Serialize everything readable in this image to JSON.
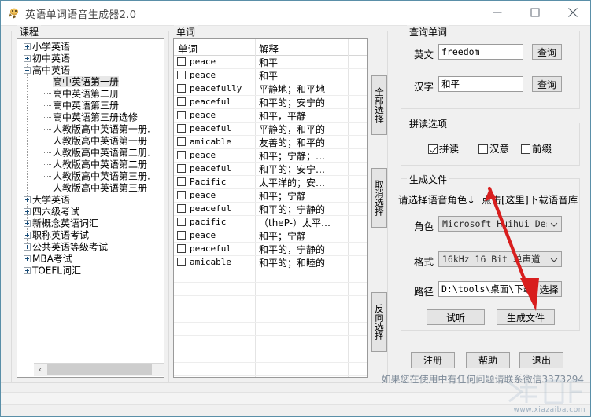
{
  "window": {
    "title": "英语单词语音生成器2.0",
    "icon": "app-icon",
    "minimize": "—",
    "maximize": "□",
    "close": "✕"
  },
  "course_panel": {
    "legend": "课程",
    "nodes": [
      {
        "label": "小学英语",
        "level": 0,
        "toggle": "plus"
      },
      {
        "label": "初中英语",
        "level": 0,
        "toggle": "plus"
      },
      {
        "label": "高中英语",
        "level": 0,
        "toggle": "minus"
      },
      {
        "label": "高中英语第一册",
        "level": 1,
        "toggle": "none",
        "selected": true
      },
      {
        "label": "高中英语第二册",
        "level": 1,
        "toggle": "none"
      },
      {
        "label": "高中英语第三册",
        "level": 1,
        "toggle": "none"
      },
      {
        "label": "高中英语第三册选修",
        "level": 1,
        "toggle": "none"
      },
      {
        "label": "人教版高中英语第一册.",
        "level": 1,
        "toggle": "none"
      },
      {
        "label": "人教版高中英语第一册",
        "level": 1,
        "toggle": "none"
      },
      {
        "label": "人教版高中英语第二册.",
        "level": 1,
        "toggle": "none"
      },
      {
        "label": "人教版高中英语第二册",
        "level": 1,
        "toggle": "none"
      },
      {
        "label": "人教版高中英语第三册.",
        "level": 1,
        "toggle": "none"
      },
      {
        "label": "人教版高中英语第三册",
        "level": 1,
        "toggle": "none"
      },
      {
        "label": "大学英语",
        "level": 0,
        "toggle": "plus"
      },
      {
        "label": "四六级考试",
        "level": 0,
        "toggle": "plus"
      },
      {
        "label": "新概念英语词汇",
        "level": 0,
        "toggle": "plus"
      },
      {
        "label": "职称英语考试",
        "level": 0,
        "toggle": "plus"
      },
      {
        "label": "公共英语等级考试",
        "level": 0,
        "toggle": "plus"
      },
      {
        "label": "MBA考试",
        "level": 0,
        "toggle": "plus"
      },
      {
        "label": "TOEFL词汇",
        "level": 0,
        "toggle": "plus"
      }
    ],
    "scroll_left": "‹",
    "scroll_right": "›"
  },
  "word_panel": {
    "legend": "单词",
    "columns": [
      "单词",
      "解释"
    ],
    "rows": [
      {
        "word": "peace",
        "meaning": "和平"
      },
      {
        "word": "peace",
        "meaning": "和平"
      },
      {
        "word": "peacefully",
        "meaning": "平静地；和平地"
      },
      {
        "word": "peaceful",
        "meaning": "和平的；安宁的"
      },
      {
        "word": "peace",
        "meaning": "和平，平静"
      },
      {
        "word": "peaceful",
        "meaning": "平静的，和平的"
      },
      {
        "word": "amicable",
        "meaning": "友善的；和平的"
      },
      {
        "word": "peace",
        "meaning": "和平；宁静；…"
      },
      {
        "word": "peaceful",
        "meaning": "和平的；安宁…"
      },
      {
        "word": "Pacific",
        "meaning": "太平洋的；安…"
      },
      {
        "word": "peace",
        "meaning": "和平；宁静"
      },
      {
        "word": "peaceful",
        "meaning": "和平的；宁静的"
      },
      {
        "word": "pacific",
        "meaning": "（theP-）太平…"
      },
      {
        "word": "peace",
        "meaning": "和平；宁静"
      },
      {
        "word": "peaceful",
        "meaning": "和平的，宁静的"
      },
      {
        "word": "amicable",
        "meaning": "和平的；和睦的"
      }
    ]
  },
  "select_buttons": {
    "select_all": "全部选择",
    "cancel_select": "取消选择",
    "invert_select": "反向选择"
  },
  "query_panel": {
    "legend": "查询单词",
    "english_label": "英文",
    "english_value": "freedom",
    "english_query_button": "查询",
    "chinese_label": "汉字",
    "chinese_value": "和平",
    "chinese_query_button": "查询"
  },
  "spell_panel": {
    "legend": "拼读选项",
    "options": [
      {
        "label": "拼读",
        "checked": true
      },
      {
        "label": "汉意",
        "checked": false
      },
      {
        "label": "前缀",
        "checked": false
      }
    ]
  },
  "generate_panel": {
    "legend": "生成文件",
    "hint_left": "请选择语音角色↓",
    "hint_right": "点击[这里]下载语音库",
    "role_label": "角色",
    "role_value": "Microsoft Huihui Deskt",
    "format_label": "格式",
    "format_value": "16kHz 16 Bit 单声道",
    "path_label": "路径",
    "path_value": "D:\\tools\\桌面\\下载吧",
    "browse_button": "选择",
    "preview_button": "试听",
    "generate_button": "生成文件"
  },
  "bottom_buttons": {
    "register": "注册",
    "help": "帮助",
    "exit": "退出"
  },
  "status": {
    "message": "如果您在使用中有任何问题请联系微信3373294",
    "watermark": "www.xiazaiba.com"
  },
  "colors": {
    "annotation_arrow": "#d81e1e",
    "window_border": "#5a8fa8",
    "panel_bg": "#f0f0f0",
    "hint_text": "#000000",
    "status_text": "#7e8b99"
  }
}
